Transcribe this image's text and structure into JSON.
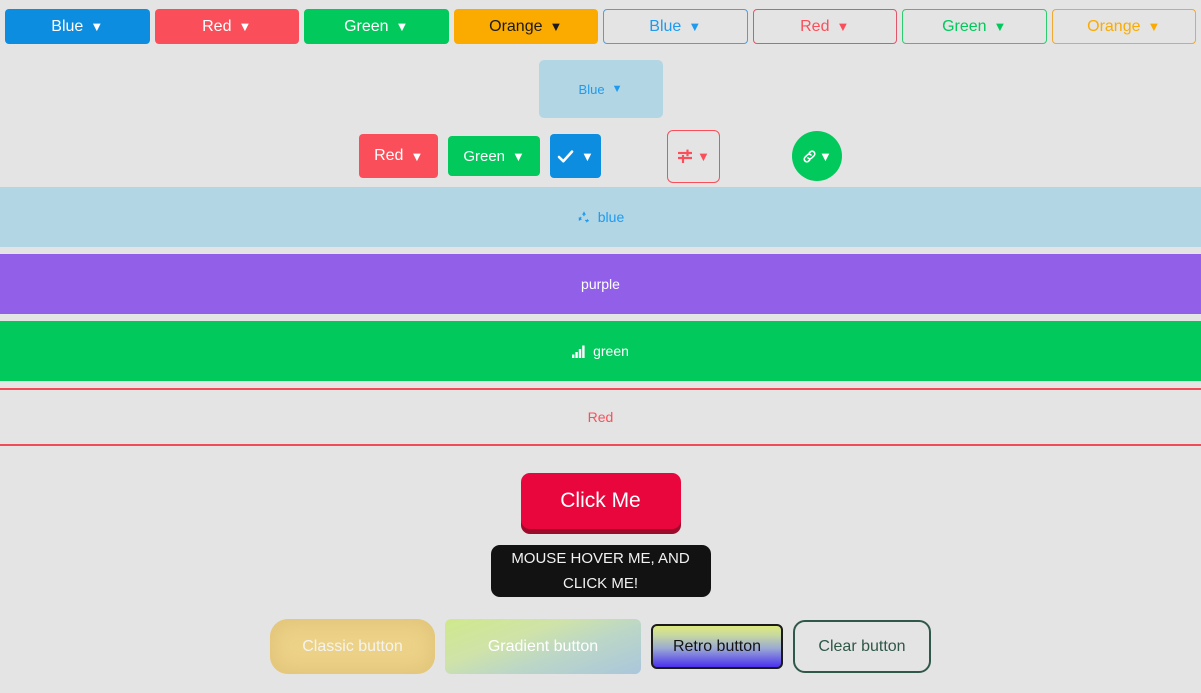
{
  "page": {
    "background": "#e4e4e4"
  },
  "top_row": {
    "buttons": [
      {
        "label": "Blue",
        "caret": "▼",
        "style": "solid",
        "color": "#0d8ddf"
      },
      {
        "label": "Red",
        "caret": "▼",
        "style": "solid",
        "color": "#fa4f5a"
      },
      {
        "label": "Green",
        "caret": "▼",
        "style": "solid",
        "color": "#01c95b"
      },
      {
        "label": "Orange",
        "caret": "▼",
        "style": "solid",
        "color": "#fbab00"
      },
      {
        "label": "Blue",
        "caret": "▼",
        "style": "outline",
        "color": "#1e9bf0"
      },
      {
        "label": "Red",
        "caret": "▼",
        "style": "outline",
        "color": "#fa4f5a"
      },
      {
        "label": "Green",
        "caret": "▼",
        "style": "outline",
        "color": "#01c95b"
      },
      {
        "label": "Orange",
        "caret": "▼",
        "style": "outline",
        "color": "#fbab00"
      }
    ]
  },
  "large_button": {
    "label": "Blue",
    "caret": "▼",
    "background": "#b2d6e4",
    "text_color": "#1e9bf0"
  },
  "mixed_row": {
    "red": {
      "label": "Red",
      "caret": "▼",
      "color": "#fa4f5a"
    },
    "green": {
      "label": "Green",
      "caret": "▼",
      "color": "#01c95b"
    },
    "check": {
      "icon": "check-icon",
      "caret": "▼",
      "color": "#0d8ddf"
    },
    "sliders": {
      "icon": "sliders-icon",
      "caret": "▼",
      "color": "#fa4f5a"
    },
    "link": {
      "icon": "link-icon",
      "caret": "▼",
      "color": "#01c95b"
    }
  },
  "blocks": [
    {
      "label": "blue",
      "icon": "recycle-icon",
      "background": "#b2d6e4",
      "text_color": "#1e9bf0"
    },
    {
      "label": "purple",
      "icon": "",
      "background": "#9260e8",
      "text_color": "#ffffff"
    },
    {
      "label": "green",
      "icon": "signal-icon",
      "background": "#01c95b",
      "text_color": "#ffffff"
    },
    {
      "label": "Red",
      "icon": "",
      "background": "transparent",
      "text_color": "#fa4f5a"
    }
  ],
  "click_button": {
    "label": "Click Me",
    "background": "#e8063c",
    "shadow_color": "#9d0b2c"
  },
  "hover_button": {
    "line1": "MOUSE HOVER ME, AND",
    "line2": "CLICK ME!",
    "background": "#121212"
  },
  "special_row": {
    "classic": "Classic button",
    "gradient": "Gradient button",
    "retro": "Retro button",
    "clear": "Clear button"
  }
}
